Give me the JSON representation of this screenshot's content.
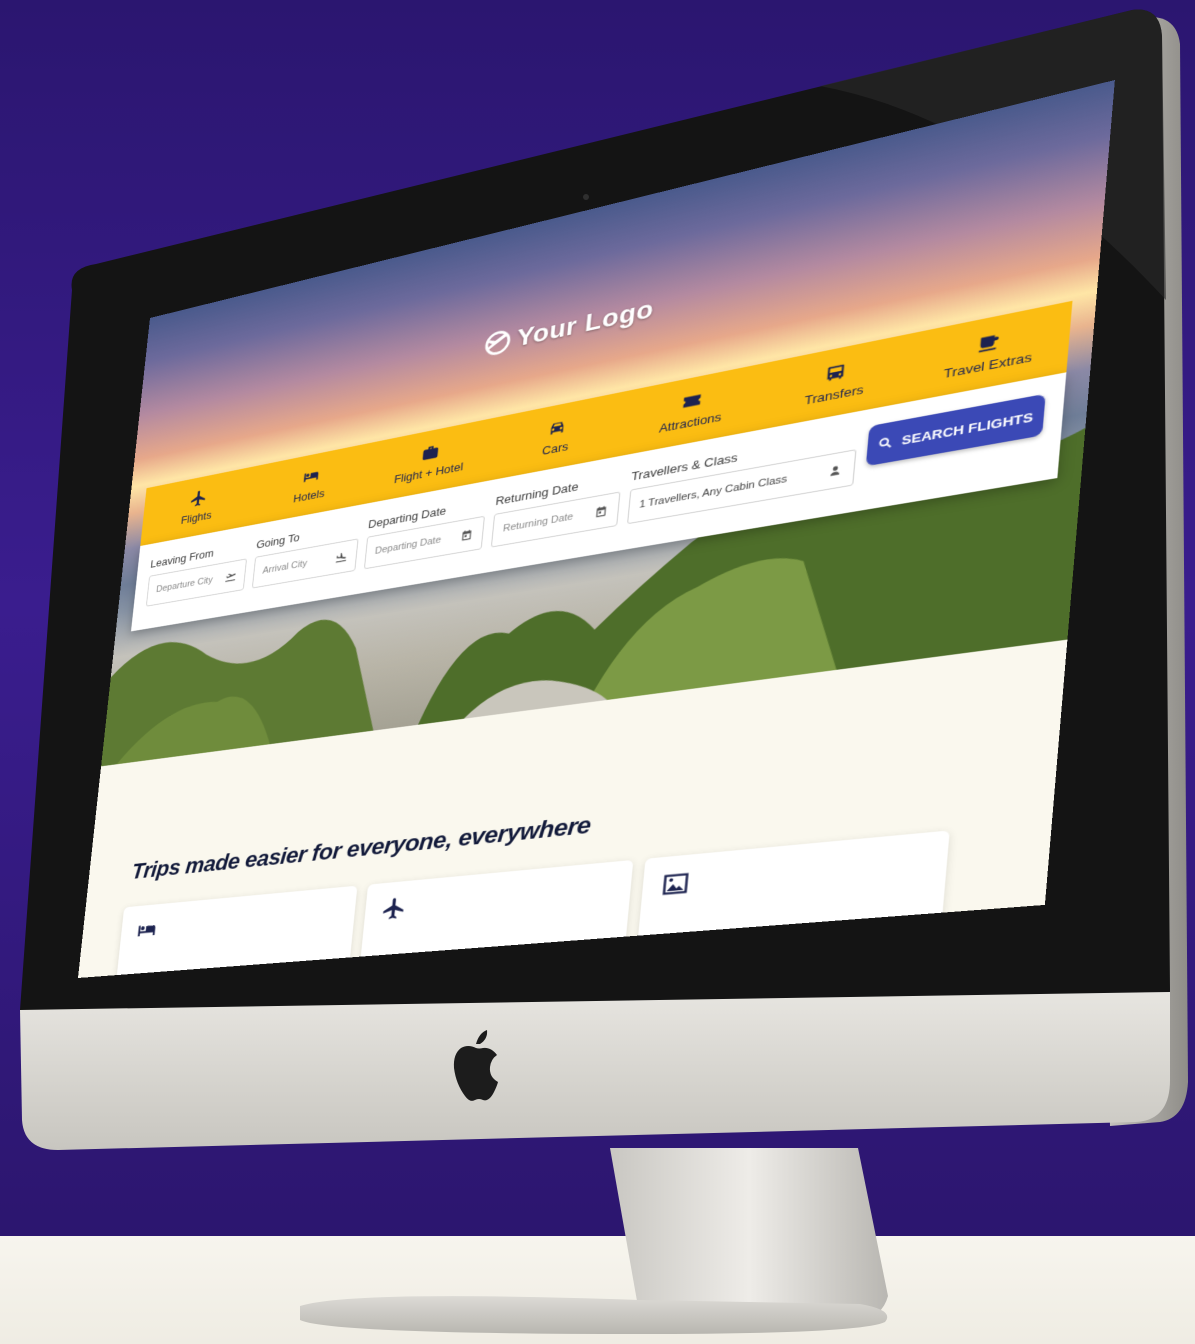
{
  "site": {
    "logo_text": "Your Logo"
  },
  "tabs": [
    {
      "label": "Flights",
      "icon": "plane-icon"
    },
    {
      "label": "Hotels",
      "icon": "bed-icon"
    },
    {
      "label": "Flight + Hotel",
      "icon": "suitcase-icon"
    },
    {
      "label": "Cars",
      "icon": "car-icon"
    },
    {
      "label": "Attractions",
      "icon": "ticket-icon"
    },
    {
      "label": "Transfers",
      "icon": "bus-icon"
    },
    {
      "label": "Travel Extras",
      "icon": "coffee-icon"
    }
  ],
  "form": {
    "leaving_from": {
      "label": "Leaving From",
      "placeholder": "Departure City"
    },
    "going_to": {
      "label": "Going To",
      "placeholder": "Arrival City"
    },
    "departing": {
      "label": "Departing Date",
      "placeholder": "Departing Date"
    },
    "returning": {
      "label": "Returning Date",
      "placeholder": "Returning Date"
    },
    "travellers": {
      "label": "Travellers & Class",
      "value": "1 Travellers, Any Cabin Class"
    },
    "search_label": "SEARCH FLIGHTS"
  },
  "content": {
    "tagline": "Trips made easier for everyone, everywhere",
    "cards": [
      {
        "icon": "bed-icon"
      },
      {
        "icon": "plane-icon"
      },
      {
        "icon": "image-icon"
      }
    ]
  },
  "colors": {
    "background": "#2b1670",
    "tab_bar": "#fbbd12",
    "search_button": "#3b49b6",
    "text_dark": "#1d2350"
  }
}
